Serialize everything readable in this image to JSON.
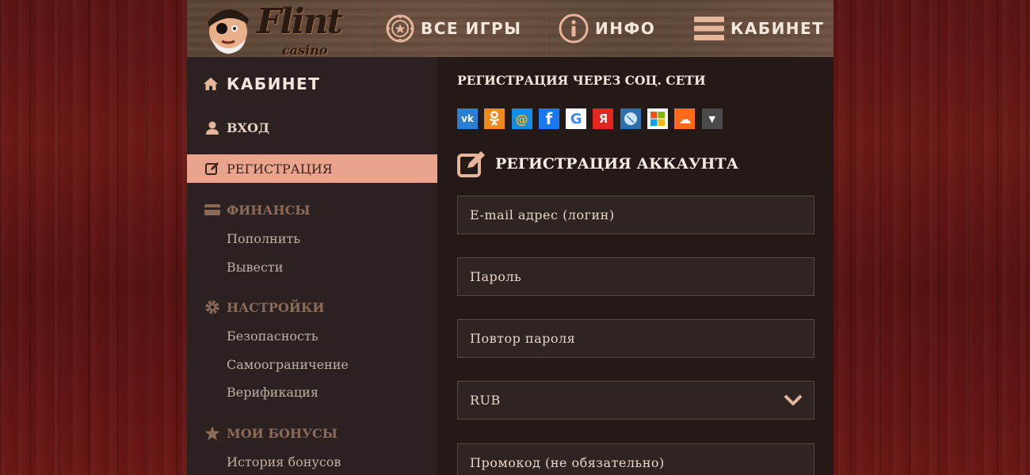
{
  "header": {
    "logo_text": "Flint",
    "logo_sub": "casino",
    "nav": [
      {
        "label": "ВСЕ ИГРЫ",
        "icon": "chip-icon"
      },
      {
        "label": "ИНФО",
        "icon": "info-icon"
      },
      {
        "label": "КАБИНЕТ",
        "icon": "menu-icon"
      }
    ]
  },
  "sidebar": {
    "title": "КАБИНЕТ",
    "login": "ВХОД",
    "registration": "РЕГИСТРАЦИЯ",
    "finance": {
      "label": "ФИНАНСЫ",
      "items": [
        "Пополнить",
        "Вывести"
      ]
    },
    "settings": {
      "label": "НАСТРОЙКИ",
      "items": [
        "Безопасность",
        "Самоограничение",
        "Верификация"
      ]
    },
    "bonuses": {
      "label": "МОИ БОНУСЫ",
      "items": [
        "История бонусов"
      ]
    }
  },
  "main": {
    "social_title": "РЕГИСТРАЦИЯ ЧЕРЕЗ СОЦ. СЕТИ",
    "social": [
      {
        "name": "vk",
        "glyph": "vk",
        "color": "#2a7fd1"
      },
      {
        "name": "odnoklassniki",
        "glyph": "ok",
        "color": "#f08a1c"
      },
      {
        "name": "mailru",
        "glyph": "@",
        "color": "#168de2"
      },
      {
        "name": "facebook",
        "glyph": "f",
        "color": "#1877f2"
      },
      {
        "name": "google",
        "glyph": "G",
        "color": "#ffffff"
      },
      {
        "name": "yandex",
        "glyph": "Я",
        "color": "#e52620"
      },
      {
        "name": "livejournal",
        "glyph": "✎",
        "color": "#2e6fae"
      },
      {
        "name": "microsoft",
        "glyph": "",
        "color": "#ffffff"
      },
      {
        "name": "soundcloud",
        "glyph": "☁",
        "color": "#ff6b1a"
      },
      {
        "name": "more",
        "glyph": "▼",
        "color": "#4a4a4a"
      }
    ],
    "reg_title": "РЕГИСТРАЦИЯ АККАУНТА",
    "fields": {
      "email": "E-mail адрес (логин)",
      "password": "Пароль",
      "password_repeat": "Повтор пароля",
      "currency": "RUB",
      "promo": "Промокод (не обязательно)"
    }
  },
  "colors": {
    "accent": "#eaa48d",
    "sidebar_bg": "#2b2120",
    "main_bg": "#231a18"
  }
}
